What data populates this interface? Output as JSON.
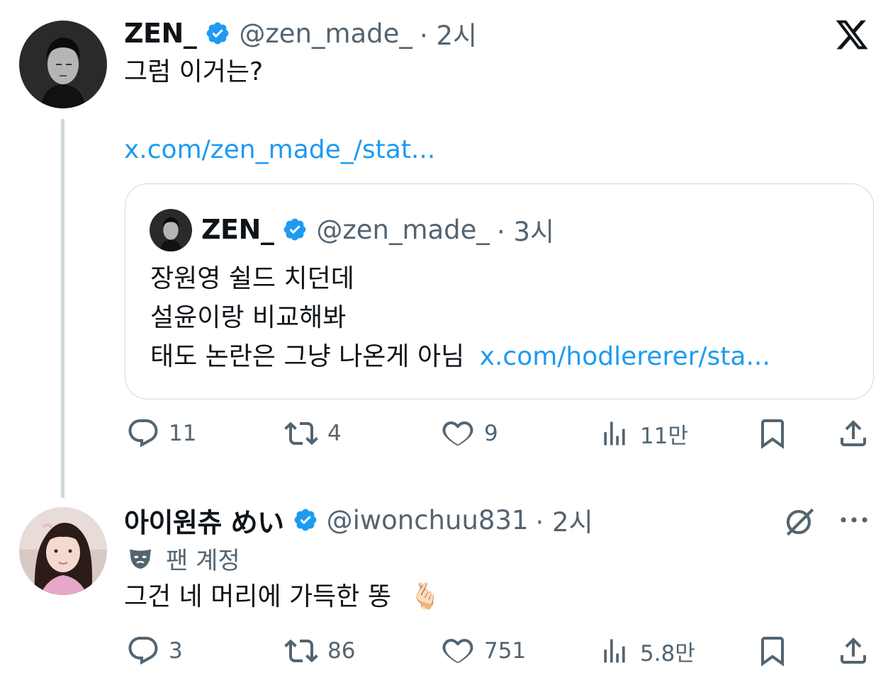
{
  "tweet1": {
    "display_name": "ZEN_",
    "handle": "@zen_made_",
    "time": "· 2시",
    "text": "그럼 이거는?",
    "link": "x.com/zen_made_/stat...",
    "quote": {
      "display_name": "ZEN_",
      "handle": "@zen_made_",
      "time": "· 3시",
      "line1": "장원영 쉴드 치던데",
      "line2": "설윤이랑 비교해봐",
      "line3": "태도 논란은 그냥 나온게 아님",
      "link": "x.com/hodlererer/sta..."
    },
    "stats": {
      "replies": "11",
      "retweets": "4",
      "likes": "9",
      "views": "11만"
    }
  },
  "tweet2": {
    "display_name": "아이원츄 めい",
    "handle": "@iwonchuu831",
    "time": "· 2시",
    "label": "팬 계정",
    "text": "그건 네 머리에 가득한 똥",
    "emoji": "🫰🏻",
    "stats": {
      "replies": "3",
      "retweets": "86",
      "likes": "751",
      "views": "5.8만"
    }
  },
  "colors": {
    "verified": "#1d9bf0",
    "link": "#1d9bf0",
    "muted": "#536471",
    "thread": "#cfd9de"
  },
  "icons": [
    "x-logo-icon",
    "verified-badge-icon",
    "reply-icon",
    "retweet-icon",
    "like-icon",
    "views-icon",
    "bookmark-icon",
    "share-icon",
    "grok-icon",
    "more-icon",
    "mask-icon"
  ]
}
